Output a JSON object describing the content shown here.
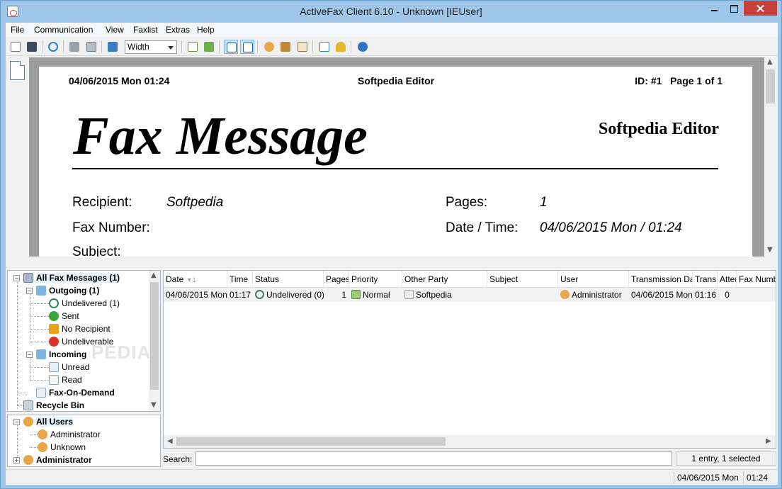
{
  "window": {
    "title": "ActiveFax Client 6.10 - Unknown [IEUser]"
  },
  "menu": [
    "File",
    "Communication",
    "View",
    "Faxlist",
    "Extras",
    "Help"
  ],
  "toolbar": {
    "zoom_value": "Width",
    "icons": {
      "new": "new-document-icon",
      "save": "save-icon",
      "refresh": "refresh-icon",
      "print": "print-icon",
      "print_preview": "print-preview-icon",
      "monitor": "monitor-icon",
      "add": "add-fax-icon",
      "add_image": "add-image-icon",
      "page_width": "page-width-icon",
      "zoom": "zoom-icon",
      "users": "users-icon",
      "book": "phonebook-icon",
      "notes": "notes-icon",
      "options": "options-icon",
      "key": "key-icon",
      "help": "help-icon"
    }
  },
  "preview": {
    "header_date": "04/06/2015 Mon 01:24",
    "header_center": "Softpedia Editor",
    "header_id": "ID: #1   Page 1 of 1",
    "title": "Fax Message",
    "sender": "Softpedia Editor",
    "fields": {
      "recipient_label": "Recipient:",
      "recipient_value": "Softpedia",
      "pages_label": "Pages:",
      "pages_value": "1",
      "fax_number_label": "Fax Number:",
      "datetime_label": "Date / Time:",
      "datetime_value": "04/06/2015 Mon / 01:24",
      "subject_label": "Subject:"
    }
  },
  "tree": {
    "root": "All Fax Messages (1)",
    "outgoing": "Outgoing (1)",
    "undelivered": "Undelivered (1)",
    "sent": "Sent",
    "no_recipient": "No Recipient",
    "undeliverable": "Undeliverable",
    "incoming": "Incoming",
    "unread": "Unread",
    "read": "Read",
    "fax_on_demand": "Fax-On-Demand",
    "recycle_bin": "Recycle Bin"
  },
  "users_tree": {
    "all_users": "All Users",
    "administrator": "Administrator",
    "unknown": "Unknown",
    "administrator_group": "Administrator"
  },
  "list": {
    "columns": [
      "Date",
      "Time",
      "Status",
      "Pages",
      "Priority",
      "Other Party",
      "Subject",
      "User",
      "Transmission Date",
      "Transm",
      "Atter",
      "Fax Numbe"
    ],
    "sort_marker": "1",
    "rows": [
      {
        "date": "04/06/2015 Mon",
        "time": "01:17",
        "status": "Undelivered (0)",
        "pages": "1",
        "priority": "Normal",
        "other_party": "Softpedia",
        "subject": "",
        "user": "Administrator",
        "transmission_date": "04/06/2015 Mon",
        "transm": "01:16",
        "attempts": "0",
        "fax_number": ""
      }
    ]
  },
  "search": {
    "label": "Search:",
    "value": ""
  },
  "list_status": "1 entry, 1 selected",
  "statusbar": {
    "date": "04/06/2015 Mon",
    "time": "01:24"
  },
  "watermark": "PEDIA",
  "colors": {
    "titlebar": "#9fc5e8",
    "close": "#c7413a",
    "selected_row": "#f2f2f2",
    "preview_bg": "#9c9c9c",
    "undelivered": "#2e8b57",
    "sent": "#3aa33a",
    "warning": "#e6a317",
    "error": "#d9322a"
  }
}
